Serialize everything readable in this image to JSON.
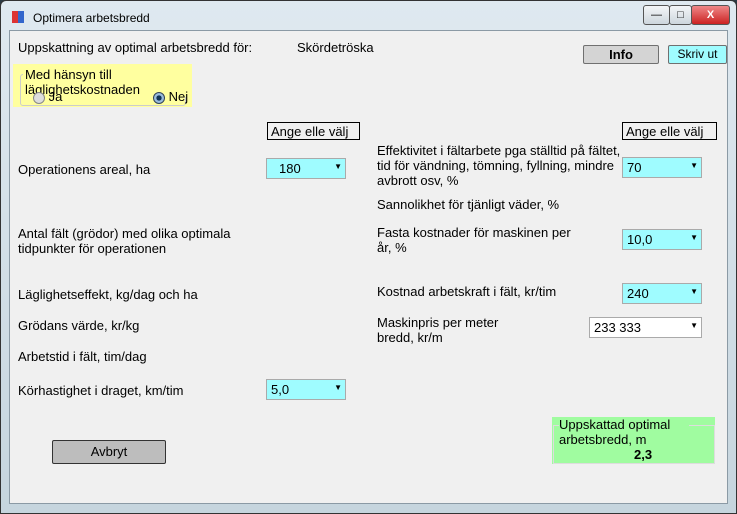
{
  "window": {
    "title": "Optimera arbetsbredd",
    "minimize": "—",
    "maximize": "□",
    "close": "X"
  },
  "header": {
    "label": "Uppskattning av optimal arbetsbredd för:",
    "machine": "Skördetröska",
    "info_label": "Info",
    "print_label": "Skriv ut"
  },
  "timeliness_group": {
    "title": "Med hänsyn till läglighetskostnaden",
    "options": [
      {
        "label": "Ja",
        "selected": false
      },
      {
        "label": "Nej",
        "selected": true
      }
    ]
  },
  "left": {
    "hint": "Ange elle välj",
    "area_label": "Operationens areal, ha",
    "area_value": "180",
    "fields_label": "Antal fält (grödor) med olika optimala tidpunkter för operationen",
    "timeliness_label": "Läglighetseffekt, kg/dag och ha",
    "crop_value_label": "Grödans värde,  kr/kg",
    "worktime_label": "Arbetstid i fält, tim/dag",
    "speed_label": "Körhastighet i draget, km/tim",
    "speed_value": "5,0"
  },
  "right": {
    "hint": "Ange elle välj",
    "efficiency_label": "Effektivitet i fältarbete pga ställtid på fältet, tid för vändning, tömning, fyllning, mindre avbrott osv, %",
    "efficiency_value": "70",
    "weather_label": "Sannolikhet för tjänligt väder,  %",
    "fixed_cost_label": "Fasta kostnader för maskinen per år, %",
    "fixed_cost_value": "10,0",
    "labour_label": "Kostnad arbetskraft i fält, kr/tim",
    "labour_value": "240",
    "price_label": "Maskinpris per meter bredd, kr/m",
    "price_value": "233 333"
  },
  "cancel_label": "Avbryt",
  "result": {
    "title": "Uppskattad optimal arbetsbredd, m",
    "value": "2,3"
  }
}
